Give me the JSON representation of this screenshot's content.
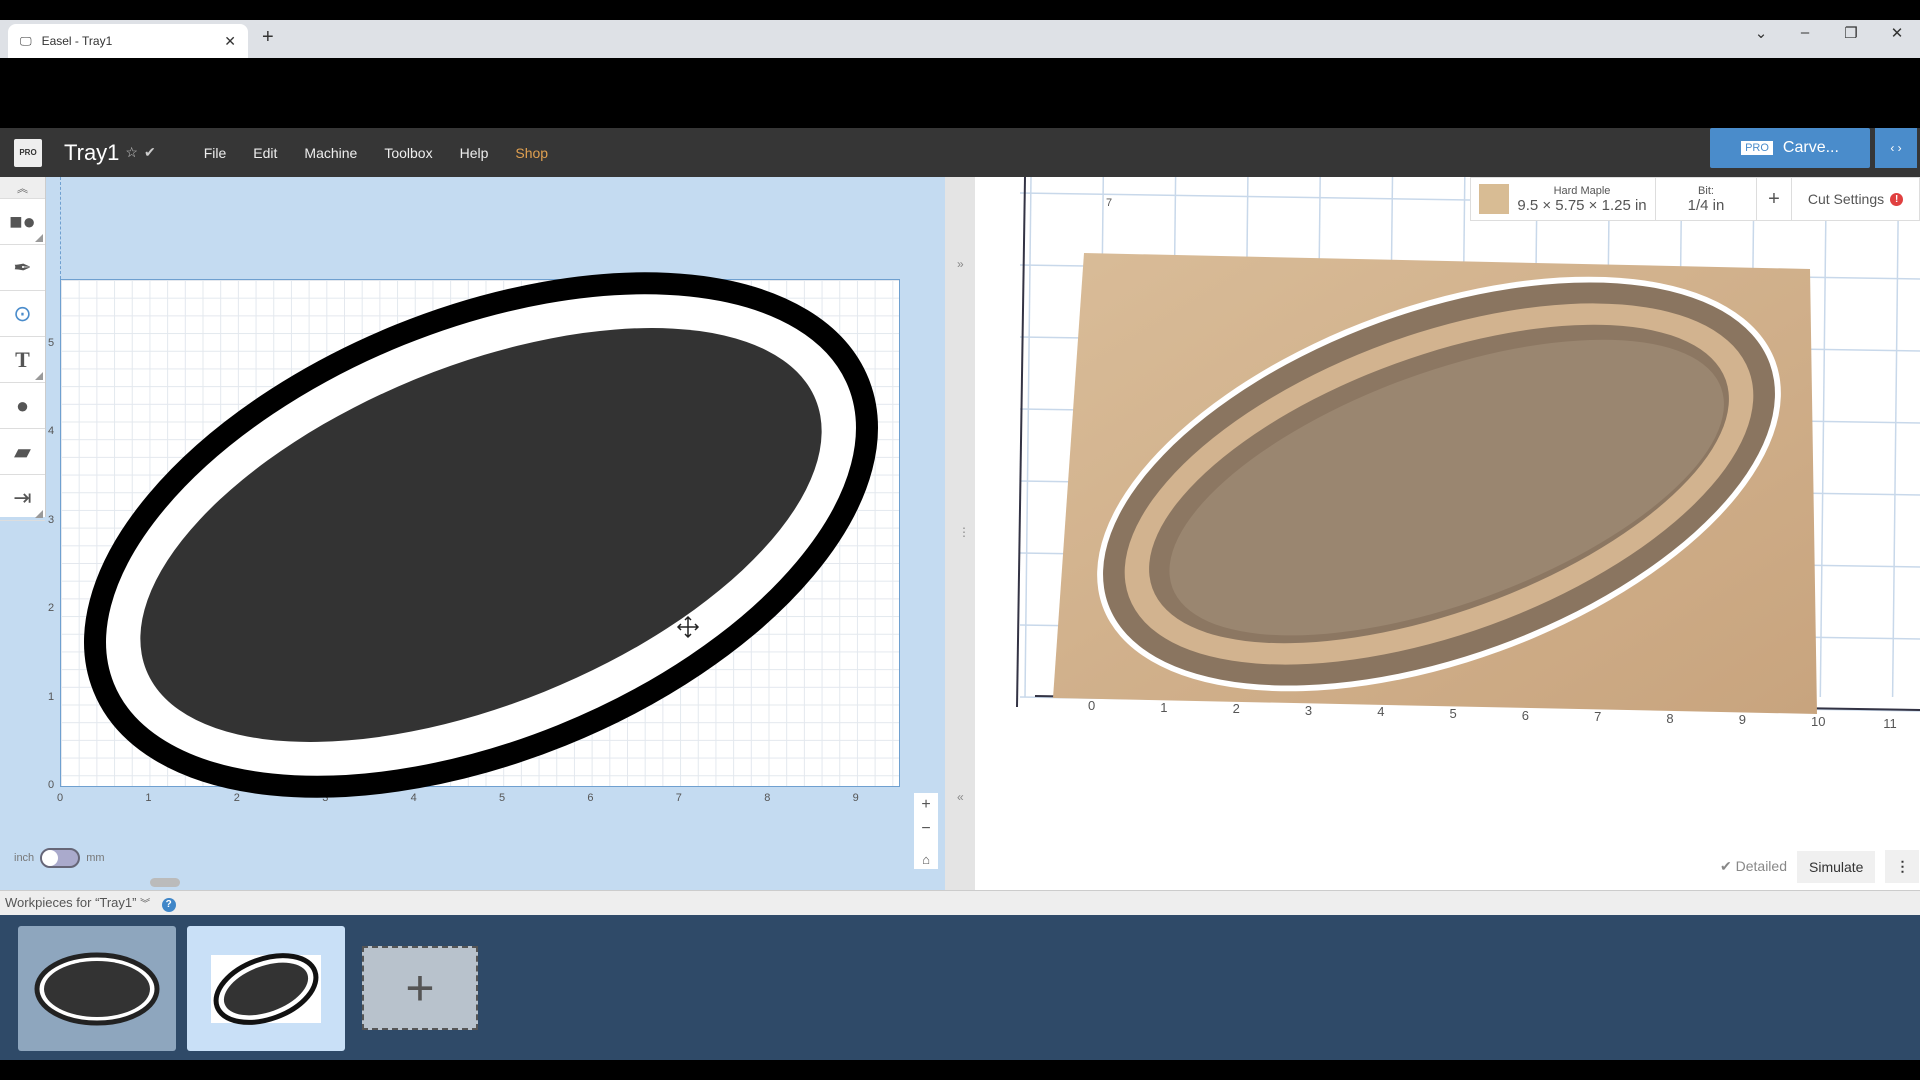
{
  "browser": {
    "tab_title": "Easel - Tray1",
    "close": "✕",
    "new_tab": "+",
    "window_controls": [
      "⌄",
      "–",
      "❐",
      "✕"
    ]
  },
  "header": {
    "logo": "PRO",
    "title": "Tray1",
    "star": "☆",
    "check": "✔",
    "menu": [
      "File",
      "Edit",
      "Machine",
      "Toolbox",
      "Help",
      "Shop"
    ],
    "carve_badge": "PRO",
    "carve_label": "Carve...",
    "expand": "‹ ›",
    "shop_color": "#e0a050",
    "accent": "#4a8ccb"
  },
  "toolbar": {
    "collapse": "︽",
    "tools": [
      "shapes",
      "pen",
      "point",
      "text",
      "apple",
      "lego",
      "import"
    ]
  },
  "canvas": {
    "x_ticks": [
      "0",
      "1",
      "2",
      "3",
      "4",
      "5",
      "6",
      "7",
      "8",
      "9"
    ],
    "y_ticks": [
      "0",
      "1",
      "2",
      "3",
      "4",
      "5"
    ],
    "unit_left": "inch",
    "unit_right": "mm",
    "zoom_in": "+",
    "zoom_out": "−",
    "home": "⌂"
  },
  "splitter": {
    "collapse_right": "»",
    "collapse_left": "«",
    "handle": "⋮"
  },
  "preview": {
    "material_name": "Hard Maple",
    "material_size": "9.5 × 5.75 × 1.25 in",
    "bit_label": "Bit:",
    "bit_value": "1/4 in",
    "add": "+",
    "cut_settings": "Cut Settings",
    "warning": "!",
    "x_ticks": [
      "0",
      "1",
      "2",
      "3",
      "4",
      "5",
      "6",
      "7",
      "8",
      "9",
      "10",
      "11"
    ],
    "y_tick": "7",
    "detailed": "Detailed",
    "simulate": "Simulate",
    "more": "⋮"
  },
  "workpieces": {
    "label": "Workpieces for “Tray1”",
    "expand": "︾",
    "help": "?",
    "add": "+"
  }
}
